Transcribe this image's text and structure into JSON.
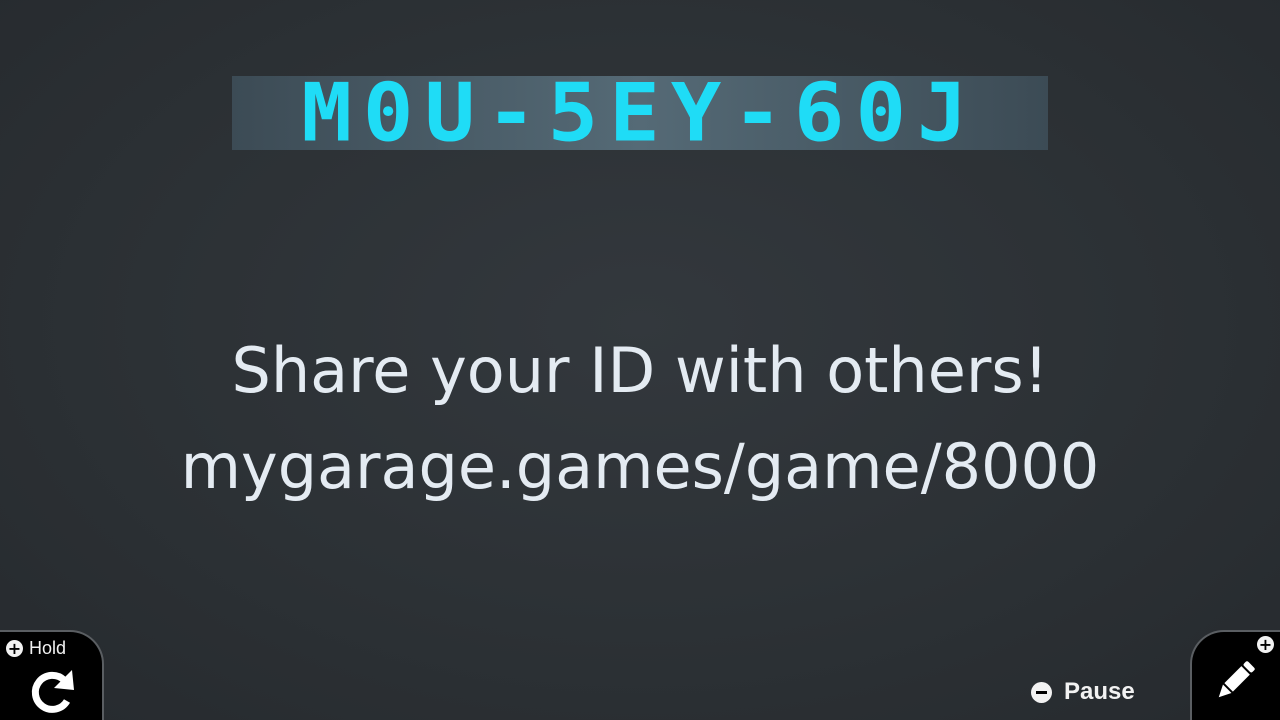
{
  "game_id": "M0U-5EY-60J",
  "share": {
    "title": "Share your ID with others!",
    "url": "mygarage.games/game/8000"
  },
  "controls": {
    "hold": {
      "badge": "+",
      "label": "Hold",
      "icon": "rotate-icon"
    },
    "pause": {
      "badge": "−",
      "label": "Pause"
    },
    "edit": {
      "badge": "+",
      "icon": "pencil-icon"
    }
  },
  "colors": {
    "id_text": "#1fdcf6",
    "banner": "#4a5c67",
    "background": "#2c3135",
    "text": "#e4ebf2"
  }
}
